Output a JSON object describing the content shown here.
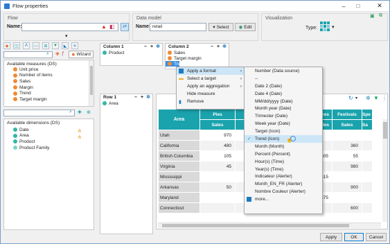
{
  "window": {
    "title": "Flow properties"
  },
  "flow": {
    "group_label": "Flow",
    "name_label": "Name:",
    "name_value": ""
  },
  "data_model": {
    "group_label": "Data model",
    "name_label": "Name:",
    "name_value": "retail",
    "select_label": "Select",
    "edit_label": "Edit"
  },
  "visualization": {
    "group_label": "Visualization",
    "type_label": "Type:"
  },
  "left_tabs": {
    "wizard_label": "Wizard"
  },
  "measures": {
    "title": "Available measures (DS)",
    "items": [
      "Unit price",
      "Number of items",
      "Sales",
      "Margin",
      "Trend",
      "Target margin"
    ]
  },
  "dimensions": {
    "title": "Available dimensions (DS)",
    "items": [
      "Date",
      "Area",
      "Product",
      "Product Family"
    ]
  },
  "column1": {
    "title": "Column 1",
    "items": [
      "Product"
    ]
  },
  "column2": {
    "title": "Column 2",
    "items": [
      "Sales",
      "Target margin",
      "Trend"
    ]
  },
  "row1": {
    "title": "Row 1",
    "items": [
      "Area"
    ]
  },
  "context_menu": {
    "items": [
      "Apply a format",
      "Select a target",
      "Apply an aggregation",
      "Hide measure",
      "Remove"
    ]
  },
  "format_menu": {
    "items": [
      "Number (Data source)",
      "--",
      "Date 2 (Date)",
      "Date 4 (Date)",
      "MM/dd/yyyy (Date)",
      "Month year (Date)",
      "Trimester (Date)",
      "Week year (Date)",
      "Target (Icon)",
      "Trend (Icon)",
      "Month (Month)",
      "Percent (Percent)",
      "Hour(s) (Time)",
      "Year(s) (Time)",
      "Indicateur (Alerter)",
      "Month_EN_FR (Alerter)",
      "Nombre Couleur (Alerter)",
      "more..."
    ],
    "selected": "Trend (Icon)"
  },
  "table": {
    "corner": "Area",
    "groups": [
      "Pies",
      "Pho",
      "heatres",
      "Festivals",
      "Spe"
    ],
    "subheaders": [
      "Sales",
      "Sales",
      "Sales",
      "Sales",
      "Sa"
    ],
    "rows": [
      {
        "area": "Utah",
        "values": [
          "970",
          "",
          "",
          "",
          ""
        ]
      },
      {
        "area": "California",
        "values": [
          "480",
          "",
          "",
          "360",
          ""
        ]
      },
      {
        "area": "British Columbia",
        "values": [
          "105",
          "",
          "605",
          "55",
          ""
        ]
      },
      {
        "area": "Virginia",
        "values": [
          "45",
          "",
          "",
          "980",
          ""
        ]
      },
      {
        "area": "Mississippi",
        "values": [
          "",
          "",
          "1,515",
          "",
          ""
        ]
      },
      {
        "area": "Arkansas",
        "values": [
          "50",
          "",
          "",
          "900",
          ""
        ]
      },
      {
        "area": "Maryland",
        "values": [
          "",
          "",
          "375",
          "",
          ""
        ]
      },
      {
        "area": "Connecticut",
        "values": [
          "",
          "",
          "",
          "600",
          ""
        ]
      }
    ]
  },
  "footer": {
    "apply_label": "Apply",
    "ok_label": "OK",
    "cancel_label": "Cancel"
  },
  "colors": {
    "table_header": "#1aa3ad",
    "accent": "#0a7ed4",
    "measure": "#ef8b33",
    "dimension": "#34b6a4"
  }
}
